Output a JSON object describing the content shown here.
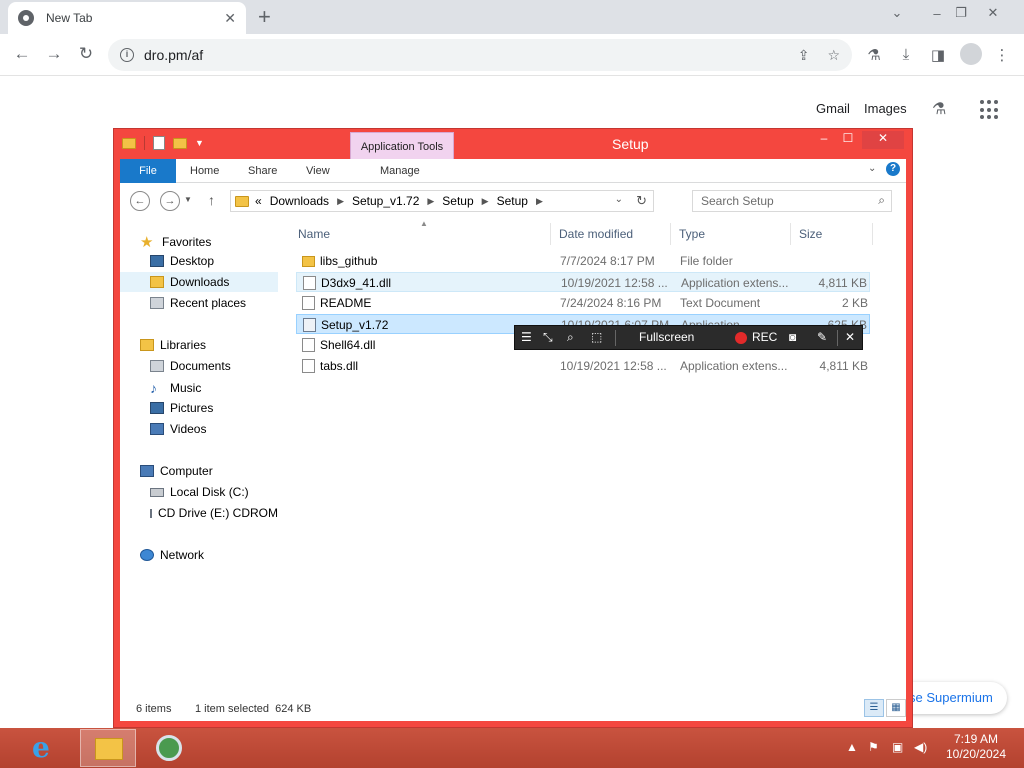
{
  "browser": {
    "tab_title": "New Tab",
    "url": "dro.pm/af",
    "links": {
      "gmail": "Gmail",
      "images": "Images"
    },
    "supermium_banner": "se Supermium"
  },
  "explorer": {
    "title": "Setup",
    "contextual_tab": "Application Tools",
    "ribbon_tabs": [
      "File",
      "Home",
      "Share",
      "View",
      "Manage"
    ],
    "breadcrumb_prefix": "«",
    "breadcrumb": [
      "Downloads",
      "Setup_v1.72",
      "Setup",
      "Setup"
    ],
    "search_placeholder": "Search Setup",
    "nav": {
      "favorites": "Favorites",
      "desktop": "Desktop",
      "downloads": "Downloads",
      "recent": "Recent places",
      "libraries": "Libraries",
      "documents": "Documents",
      "music": "Music",
      "pictures": "Pictures",
      "videos": "Videos",
      "computer": "Computer",
      "local_disk": "Local Disk (C:)",
      "cd_drive": "CD Drive (E:) CDROM",
      "network": "Network"
    },
    "columns": {
      "name": "Name",
      "date": "Date modified",
      "type": "Type",
      "size": "Size"
    },
    "files": [
      {
        "name": "libs_github",
        "date": "7/7/2024 8:17 PM",
        "type": "File folder",
        "size": ""
      },
      {
        "name": "D3dx9_41.dll",
        "date": "10/19/2021 12:58 ...",
        "type": "Application extens...",
        "size": "4,811 KB"
      },
      {
        "name": "README",
        "date": "7/24/2024 8:16 PM",
        "type": "Text Document",
        "size": "2 KB"
      },
      {
        "name": "Setup_v1.72",
        "date": "10/19/2021 6:07 PM",
        "type": "Application",
        "size": "625 KB"
      },
      {
        "name": "Shell64.dll",
        "date": "",
        "type": "",
        "size": ""
      },
      {
        "name": "tabs.dll",
        "date": "10/19/2021 12:58 ...",
        "type": "Application extens...",
        "size": "4,811 KB"
      }
    ],
    "status": {
      "count": "6 items",
      "selection": "1 item selected  624 KB"
    }
  },
  "recorder": {
    "fullscreen": "Fullscreen",
    "rec": "REC"
  },
  "taskbar": {
    "time": "7:19 AM",
    "date": "10/20/2024"
  }
}
